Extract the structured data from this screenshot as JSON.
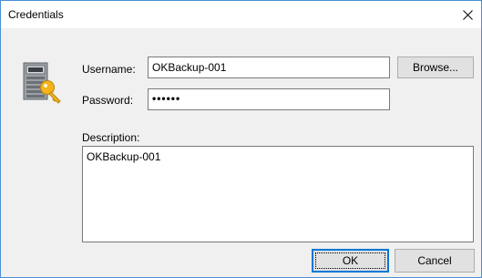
{
  "window": {
    "title": "Credentials",
    "close_glyph": "close-icon"
  },
  "icons": {
    "credentials": "credentials-key-icon"
  },
  "form": {
    "username_label": "Username:",
    "username_value": "OKBackup-001",
    "browse_label": "Browse...",
    "password_label": "Password:",
    "password_mask": "••••••",
    "description_label": "Description:",
    "description_value": "OKBackup-001"
  },
  "buttons": {
    "ok_label": "OK",
    "cancel_label": "Cancel"
  },
  "colors": {
    "window_border": "#4a8fd6",
    "dialog_bg": "#f0f0f0",
    "default_button_border": "#0078d7"
  }
}
